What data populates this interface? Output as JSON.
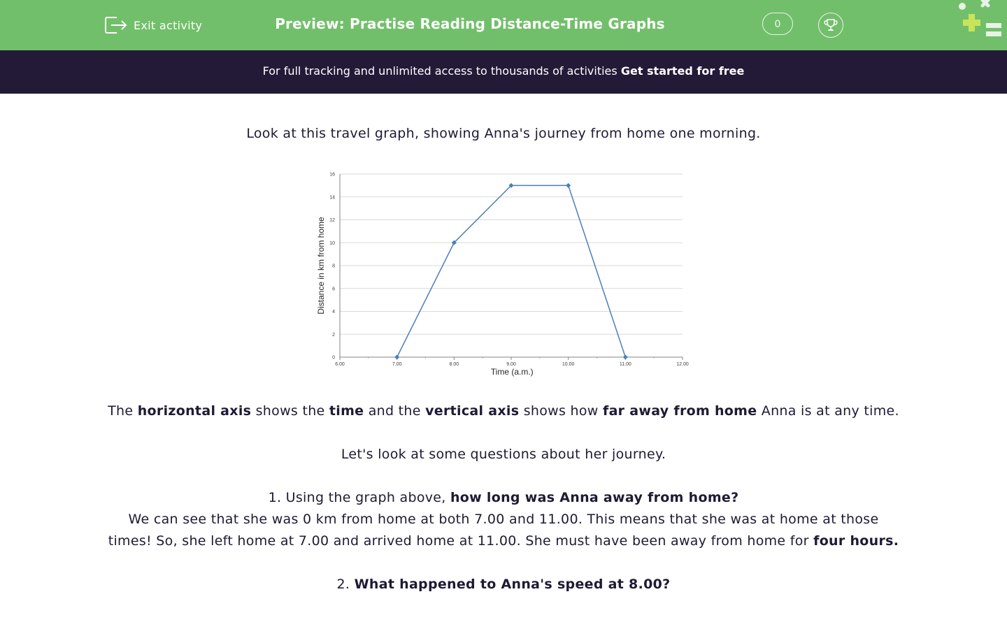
{
  "header": {
    "exit_label": "Exit activity",
    "title": "Preview: Practise Reading Distance-Time Graphs",
    "score": "0"
  },
  "banner": {
    "text": "For full tracking and unlimited access to thousands of activities",
    "cta": "Get started for free"
  },
  "content": {
    "intro": "Look at this travel graph, showing Anna's journey from home one morning.",
    "axis_expl": {
      "t1": "The ",
      "b1": "horizontal axis",
      "t2": " shows the ",
      "b2": "time",
      "t3": " and the ",
      "b3": "vertical axis",
      "t4": " shows how ",
      "b4": "far away from home",
      "t5": " Anna is at any time."
    },
    "lets_look": "Let's look at some questions about her journey.",
    "q1": {
      "prefix": "1. Using the graph above, ",
      "bold": "how long was Anna away from home?"
    },
    "a1": {
      "text": "We can see that she was 0 km from home at both 7.00 and 11.00. This means that she was at home at those times! So, she left home at 7.00 and arrived home at 11.00. She must have been away from home for ",
      "bold": "four hours."
    },
    "q2": {
      "prefix": "2. ",
      "bold": "What happened to Anna's speed at 8.00?"
    }
  },
  "chart_data": {
    "type": "line",
    "xlabel": "Time (a.m.)",
    "ylabel": "Distance in km from home",
    "x_ticks": [
      "6.00",
      "7.00",
      "8.00",
      "9.00",
      "10.00",
      "11.00",
      "12.00"
    ],
    "y_ticks": [
      "0",
      "2",
      "4",
      "6",
      "8",
      "10",
      "12",
      "14",
      "16"
    ],
    "xlim": [
      6,
      12
    ],
    "ylim": [
      0,
      16
    ],
    "grid": "horizontal",
    "series": [
      {
        "x": [
          7,
          8,
          9,
          10,
          11
        ],
        "y": [
          0,
          10,
          15,
          15,
          0
        ]
      }
    ],
    "colors": {
      "line": "#4a7ebb",
      "grid": "#d9d9d9",
      "axis": "#868686"
    }
  },
  "colors": {
    "topbar": "#72bf6b",
    "banner": "#231a37",
    "text": "#1e1a33"
  }
}
